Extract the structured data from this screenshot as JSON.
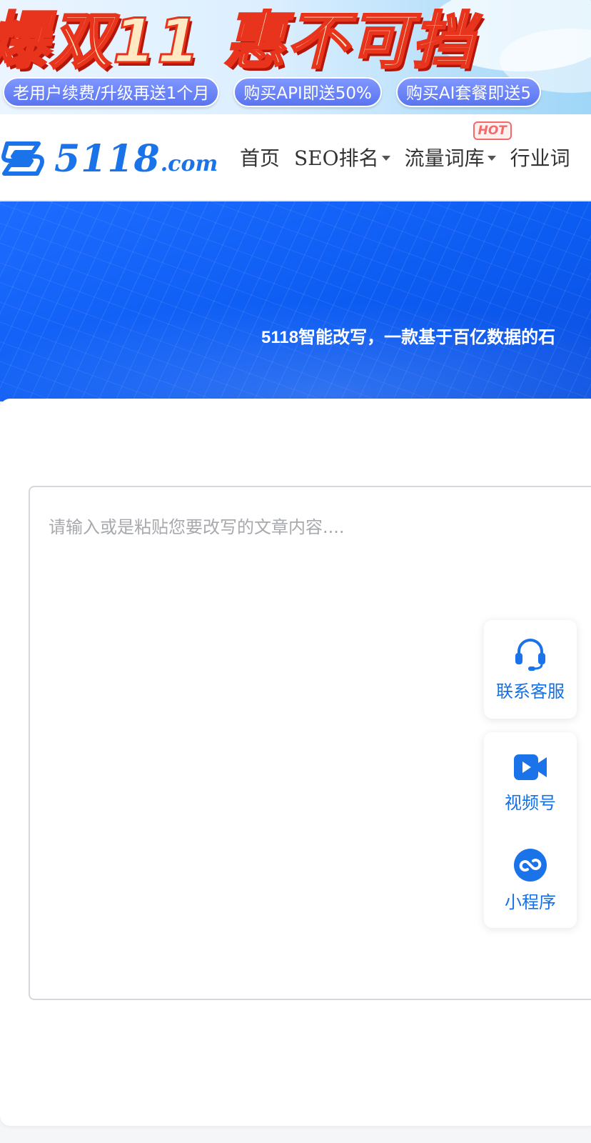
{
  "promo": {
    "headline": "爆双11 惠不可挡",
    "pills": [
      "老用户续费/升级再送1个月",
      "购买API即送50%",
      "购买AI套餐即送5"
    ]
  },
  "nav": {
    "logo_text": "5118",
    "logo_suffix": ".com",
    "items": [
      {
        "label": "首页"
      },
      {
        "label": "SEO排名",
        "dropdown": true
      },
      {
        "label": "流量词库",
        "dropdown": true,
        "badge": "HOT"
      },
      {
        "label": "行业词"
      }
    ]
  },
  "hero": {
    "subtitle": "5118智能改写，一款基于百亿数据的石"
  },
  "editor": {
    "placeholder": "请输入或是粘贴您要改写的文章内容....",
    "value": ""
  },
  "side_tools": {
    "support": {
      "label": "联系客服",
      "icon": "headset-icon"
    },
    "video": {
      "label": "视频号",
      "icon": "video-camera-icon"
    },
    "mini_program": {
      "label": "小程序",
      "icon": "mini-program-icon"
    }
  },
  "colors": {
    "brand": "#1a73e8",
    "hero": "#0d5cf2",
    "hot": "#f26a6a"
  }
}
